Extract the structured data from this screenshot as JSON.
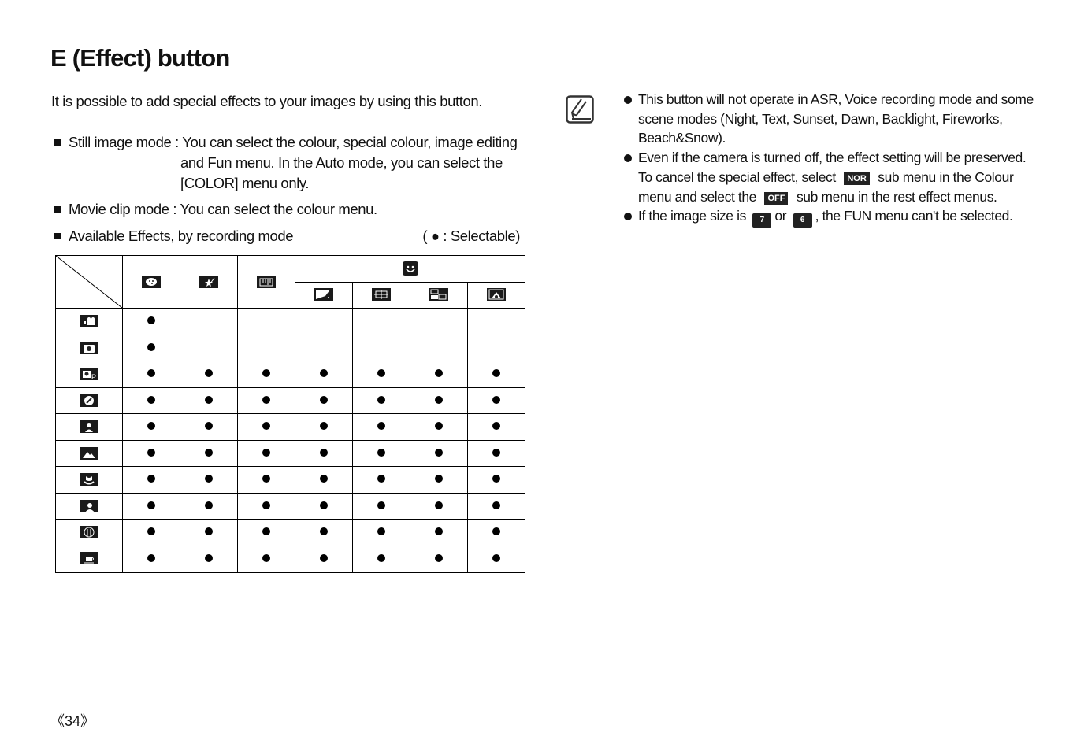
{
  "page": {
    "title": "E (Effect) button",
    "intro": "It is possible to add special effects to your images by using this button.",
    "still_label": "Still image mode : ",
    "still_lines": [
      "You can select the colour, special colour, image editing",
      "and Fun menu. In the Auto mode, you can  select the",
      "[COLOR] menu only."
    ],
    "movie": "Movie clip mode : You can select the colour menu.",
    "avail": "Available Effects, by recording mode",
    "legend": "( ● : Selectable)",
    "page_number": "《34》"
  },
  "table": {
    "group_header_icon": "fun-icon",
    "columns": [
      {
        "icon": "colour-palette-icon"
      },
      {
        "icon": "special-colour-icon"
      },
      {
        "icon": "image-editing-icon"
      },
      {
        "icon": "fun-cartoon-icon"
      },
      {
        "icon": "fun-photo-frame-icon"
      },
      {
        "icon": "fun-composite-icon"
      },
      {
        "icon": "fun-sticker-icon"
      }
    ],
    "rows": [
      {
        "mode_icon": "movie-clip-icon",
        "values": [
          true,
          false,
          false,
          false,
          false,
          false,
          false
        ]
      },
      {
        "mode_icon": "auto-icon",
        "values": [
          true,
          false,
          false,
          false,
          false,
          false,
          false
        ]
      },
      {
        "mode_icon": "program-icon",
        "values": [
          true,
          true,
          true,
          true,
          true,
          true,
          true
        ]
      },
      {
        "mode_icon": "dis-icon",
        "values": [
          true,
          true,
          true,
          true,
          true,
          true,
          true
        ]
      },
      {
        "mode_icon": "portrait-scene-icon",
        "values": [
          true,
          true,
          true,
          true,
          true,
          true,
          true
        ]
      },
      {
        "mode_icon": "landscape-icon",
        "values": [
          true,
          true,
          true,
          true,
          true,
          true,
          true
        ]
      },
      {
        "mode_icon": "close-up-icon",
        "values": [
          true,
          true,
          true,
          true,
          true,
          true,
          true
        ]
      },
      {
        "mode_icon": "portrait-icon",
        "values": [
          true,
          true,
          true,
          true,
          true,
          true,
          true
        ]
      },
      {
        "mode_icon": "food-icon",
        "values": [
          true,
          true,
          true,
          true,
          true,
          true,
          true
        ]
      },
      {
        "mode_icon": "cafe-icon",
        "values": [
          true,
          true,
          true,
          true,
          true,
          true,
          true
        ]
      }
    ]
  },
  "notes": {
    "n1": "This button will not operate in ASR, Voice recording mode and some scene modes (Night, Text, Sunset, Dawn, Backlight, Fireworks, Beach&Snow).",
    "n2a": "Even if the camera is turned off, the effect setting will be preserved. To cancel the special effect, select",
    "nor_badge": "NOR",
    "n2b": "sub menu in the Colour menu and select the",
    "off_badge": "OFF",
    "n2c": "sub menu in the rest effect menus.",
    "n3a": "If the image size is",
    "size1": "7",
    "n3b": "or",
    "size2": "6",
    "n3c": ", the FUN menu can't be selected."
  }
}
